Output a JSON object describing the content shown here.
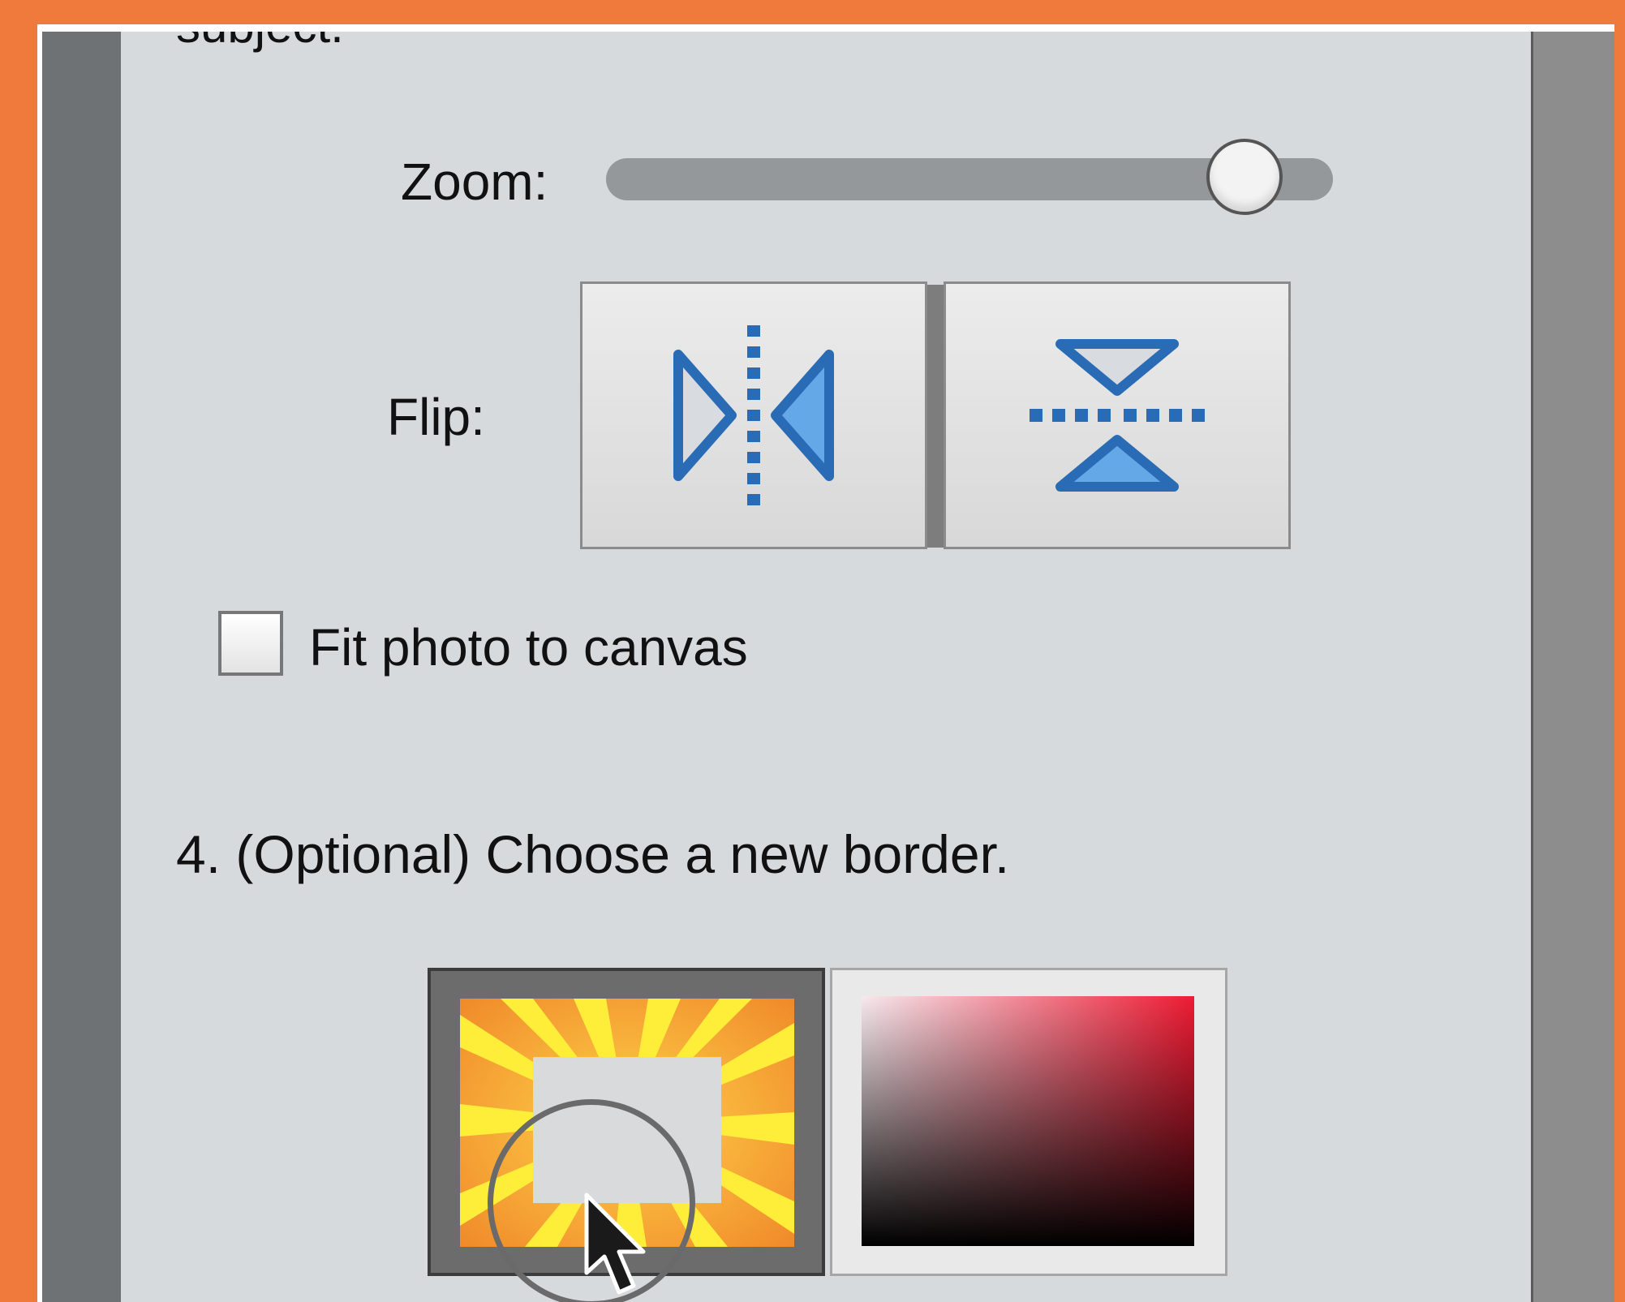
{
  "panel": {
    "subject_text": "subject.",
    "zoom": {
      "label": "Zoom:",
      "value_fraction": 0.83
    },
    "flip": {
      "label": "Flip:",
      "buttons": [
        {
          "name": "flip-horizontal",
          "icon": "flip-horizontal-icon"
        },
        {
          "name": "flip-vertical",
          "icon": "flip-vertical-icon"
        }
      ]
    },
    "fit_checkbox": {
      "label": "Fit photo to canvas",
      "checked": false
    },
    "step4": {
      "text": "4. (Optional) Choose a new border."
    },
    "borders": [
      {
        "name": "sunburst-border",
        "selected": true
      },
      {
        "name": "red-gradient-border",
        "selected": false
      }
    ]
  },
  "colors": {
    "frame_orange": "#ef7a3b",
    "panel_bg": "#d7dadd",
    "icon_blue": "#2a6bb5",
    "icon_fill": "#64a8e8"
  },
  "cursor": {
    "type": "arrow-cursor",
    "highlight": "click-ring"
  }
}
